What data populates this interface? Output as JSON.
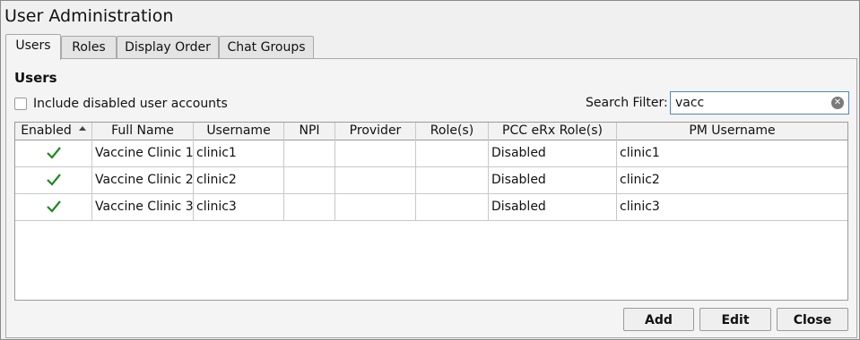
{
  "window": {
    "title": "User Administration"
  },
  "tabs": [
    {
      "label": "Users",
      "active": true
    },
    {
      "label": "Roles",
      "active": false
    },
    {
      "label": "Display Order",
      "active": false
    },
    {
      "label": "Chat Groups",
      "active": false
    }
  ],
  "panel": {
    "section_title": "Users",
    "include_disabled": {
      "label": "Include disabled user accounts",
      "checked": false
    },
    "search": {
      "label": "Search Filter:",
      "value": "vacc",
      "clear_icon": "clear-circle-icon"
    }
  },
  "table": {
    "sort_column": "Enabled",
    "sort_direction": "ascending",
    "columns": [
      "Enabled",
      "Full Name",
      "Username",
      "NPI",
      "Provider",
      "Role(s)",
      "PCC eRx Role(s)",
      "PM Username"
    ],
    "rows": [
      {
        "enabled": true,
        "full_name": "Vaccine Clinic 1",
        "username": "clinic1",
        "npi": "",
        "provider": "",
        "roles": "",
        "erx_roles": "Disabled",
        "pm_username": "clinic1"
      },
      {
        "enabled": true,
        "full_name": "Vaccine Clinic 2",
        "username": "clinic2",
        "npi": "",
        "provider": "",
        "roles": "",
        "erx_roles": "Disabled",
        "pm_username": "clinic2"
      },
      {
        "enabled": true,
        "full_name": "Vaccine Clinic 3",
        "username": "clinic3",
        "npi": "",
        "provider": "",
        "roles": "",
        "erx_roles": "Disabled",
        "pm_username": "clinic3"
      }
    ]
  },
  "buttons": {
    "add": "Add",
    "edit": "Edit",
    "close": "Close"
  },
  "colors": {
    "accent": "#4a88c7",
    "check": "#1e8a1e"
  }
}
